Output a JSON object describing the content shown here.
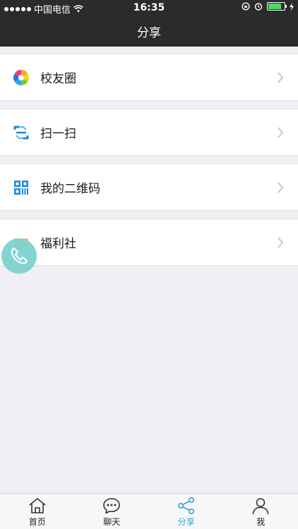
{
  "status_bar": {
    "carrier": "中国电信",
    "time": "16:35"
  },
  "nav": {
    "title": "分享"
  },
  "menu": [
    {
      "label": "校友圈",
      "icon": "aperture-icon"
    },
    {
      "label": "扫一扫",
      "icon": "scan-icon"
    },
    {
      "label": "我的二维码",
      "icon": "qrcode-icon"
    },
    {
      "label": "福利社",
      "icon": "gift-icon"
    }
  ],
  "tabs": [
    {
      "label": "首页",
      "icon": "home-icon"
    },
    {
      "label": "聊天",
      "icon": "chat-icon"
    },
    {
      "label": "分享",
      "icon": "share-icon",
      "active": true
    },
    {
      "label": "我",
      "icon": "person-icon"
    }
  ],
  "colors": {
    "accent": "#2aa6db",
    "navbar": "#2b2b2b",
    "background": "#efeff4",
    "float": "#7ed3cf"
  }
}
